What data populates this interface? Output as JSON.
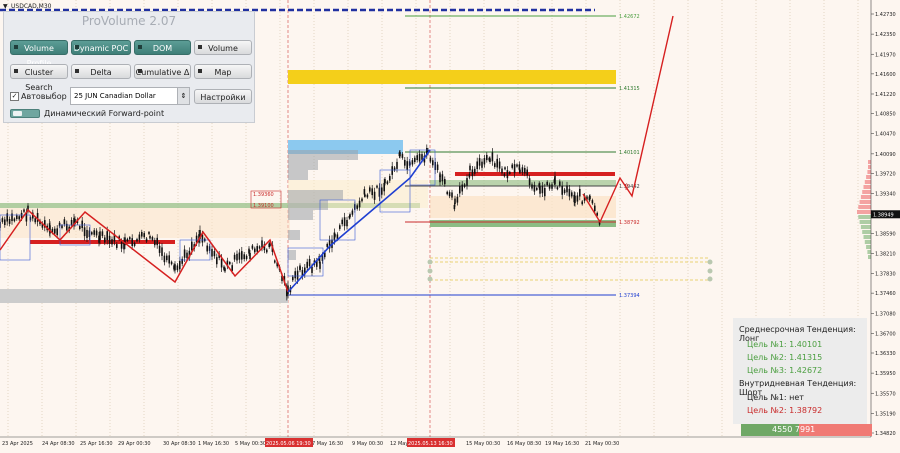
{
  "symbol": "USDCAD,M30",
  "panel": {
    "title": "ProVolume 2.07",
    "buttons": [
      {
        "label": "Volume Profile",
        "active": true
      },
      {
        "label": "Dynamic POC",
        "active": true
      },
      {
        "label": "DOM",
        "active": true
      },
      {
        "label": "Volume",
        "active": false
      },
      {
        "label": "Cluster Search",
        "active": false
      },
      {
        "label": "Delta",
        "active": false
      },
      {
        "label": "Cumulative Δ",
        "active": false
      },
      {
        "label": "Map",
        "active": false
      }
    ],
    "autoselect_label": "Автовыбор",
    "autoselect_checked": true,
    "contract_value": "25 JUN Canadian Dollar",
    "settings_label": "Настройки",
    "forward_point_label": "Динамический Forward-point"
  },
  "price_axis": {
    "labels": [
      "1.42730",
      "1.42350",
      "1.41970",
      "1.41600",
      "1.41220",
      "1.40850",
      "1.40470",
      "1.40090",
      "1.39720",
      "1.39340",
      "1.38960",
      "1.38590",
      "1.38210",
      "1.37830",
      "1.37460",
      "1.37080",
      "1.36700",
      "1.36330",
      "1.35950",
      "1.35570",
      "1.35190",
      "1.34820"
    ],
    "current_price": "1.38949"
  },
  "time_axis": {
    "labels": [
      "23 Apr 2025",
      "24 Apr 08:30",
      "25 Apr 16:30",
      "29 Apr 00:30",
      "30 Apr 08:30",
      "1 May 16:30",
      "5 May 00:30",
      "7 May 16:30",
      "9 May 00:30",
      "12 May 08:30",
      "15 May 00:30",
      "16 May 08:30",
      "19 May 16:30",
      "21 May 00:30"
    ],
    "highlighted": [
      "2025.05.06 19:30",
      "2025.05.13 16:30"
    ]
  },
  "chart_levels": {
    "labels": [
      "1.42672",
      "1.41315",
      "1.40101",
      "1.39442",
      "1.38792",
      "1.37394"
    ],
    "small_labels": [
      "1.39360",
      "1.39100"
    ]
  },
  "info_box": {
    "medium_title": "Среднесрочная Тенденция: Лонг",
    "medium_targets": [
      "Цель №1: 1.40101",
      "Цель №2: 1.41315",
      "Цель №3: 1.42672"
    ],
    "intraday_title": "Внутридневная Тенденция: Шорт",
    "intraday_targets": [
      "Цель №1: нет",
      "Цель №2: 1.38792"
    ]
  },
  "volume_bar": {
    "text": "4550 7991"
  },
  "colors": {
    "long": "#4a9e3f",
    "short": "#c92b2b",
    "accent": "#3f7f78",
    "trend_up": "#1f3fd1"
  }
}
